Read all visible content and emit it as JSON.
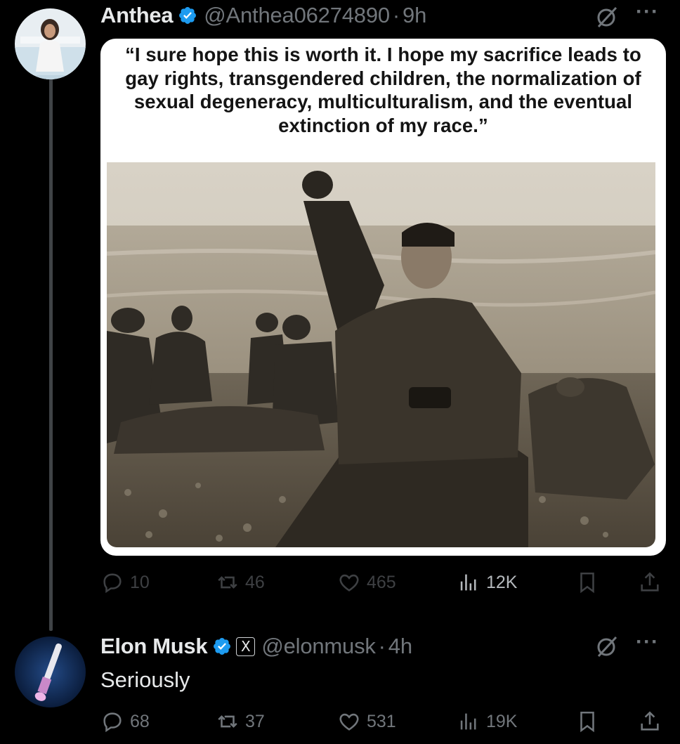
{
  "tweet": {
    "author_name": "Anthea",
    "author_handle": "@Anthea06274890",
    "separator": "·",
    "time": "9h",
    "quote_text": "“I sure hope this is worth it. I hope my sacrifice leads to gay rights, transgendered children, the normalization of sexual degeneracy, multiculturalism, and the eventual extinction of my race.”",
    "stats": {
      "replies": "10",
      "reposts": "46",
      "likes": "465",
      "views": "12K"
    }
  },
  "reply": {
    "author_name": "Elon Musk",
    "author_handle": "@elonmusk",
    "separator": "·",
    "time": "4h",
    "x_badge": "X",
    "text": "Seriously",
    "stats": {
      "replies": "68",
      "reposts": "37",
      "likes": "531",
      "views": "19K"
    }
  },
  "more_menu": "···",
  "colors": {
    "background": "#000000",
    "text": "#e7e9ea",
    "muted": "#71767b",
    "verified": "#1d9bf0",
    "thread_line": "#3f4346"
  },
  "icons": [
    "verified-badge-icon",
    "grok-icon",
    "more-icon",
    "reply-icon",
    "repost-icon",
    "like-icon",
    "views-icon",
    "bookmark-icon",
    "share-icon"
  ]
}
